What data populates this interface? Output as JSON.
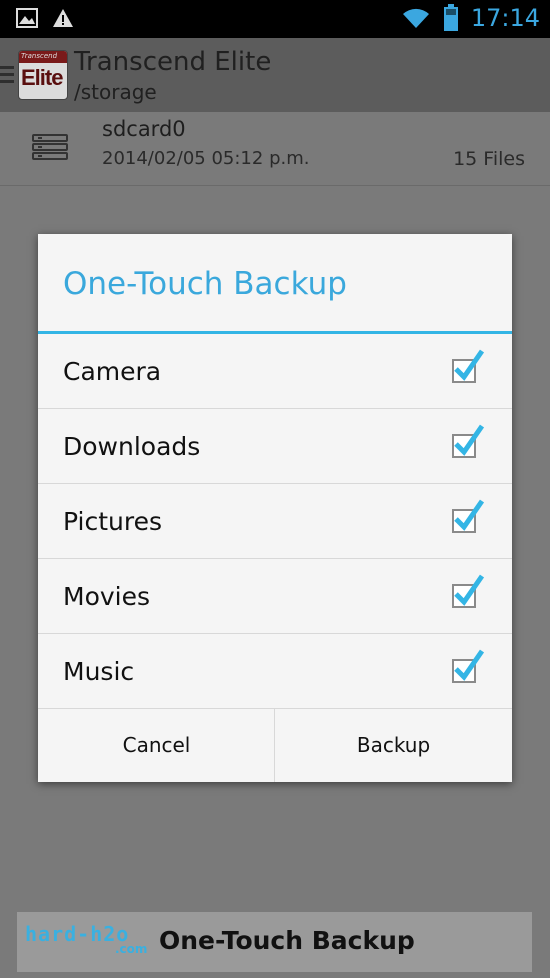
{
  "status_bar": {
    "time": "17:14",
    "icons": [
      "image-icon",
      "warning-icon",
      "wifi-icon",
      "battery-icon"
    ]
  },
  "app_bar": {
    "title": "Transcend Elite",
    "subtitle": "/storage",
    "logo_brand": "Transcend",
    "logo_mark": "Elite"
  },
  "storage_row": {
    "name": "sdcard0",
    "date": "2014/02/05 05:12 p.m.",
    "count": "15 Files"
  },
  "dialog": {
    "title": "One-Touch Backup",
    "options": [
      {
        "label": "Camera",
        "checked": true
      },
      {
        "label": "Downloads",
        "checked": true
      },
      {
        "label": "Pictures",
        "checked": true
      },
      {
        "label": "Movies",
        "checked": true
      },
      {
        "label": "Music",
        "checked": true
      }
    ],
    "cancel_label": "Cancel",
    "backup_label": "Backup",
    "accent_color": "#33b5e5"
  },
  "caption": {
    "watermark": "hard-h2o",
    "watermark_sub": ".com",
    "text": "One-Touch Backup"
  }
}
